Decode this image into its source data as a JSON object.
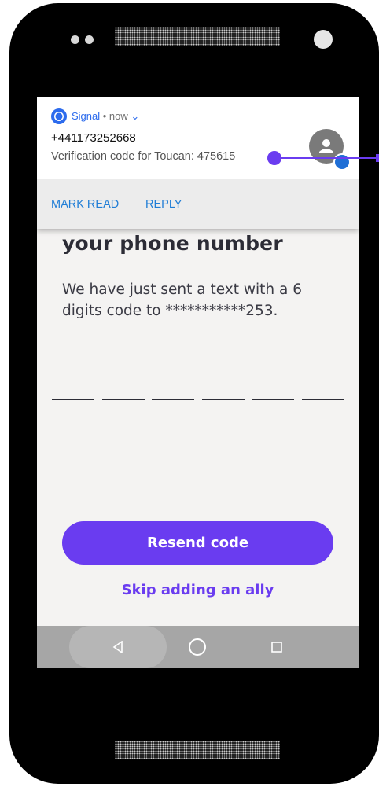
{
  "notification": {
    "app_name": "Signal",
    "separator": " • ",
    "time": "now",
    "chevron": "⌄",
    "sender": "+441173252668",
    "message": "Verification code for Toucan: 475615",
    "actions": [
      "MARK READ",
      "REPLY"
    ]
  },
  "screen": {
    "heading": "your phone number",
    "subtext": "We have just sent a text with a 6 digits code to ***********253.",
    "resend_label": "Resend code",
    "skip_label": "Skip adding an ally"
  },
  "colors": {
    "accent": "#6a3cf0",
    "signal_blue": "#2c6bed",
    "action_blue": "#1f7dd6"
  },
  "icons": [
    "signal-logo-icon",
    "chevron-down-icon",
    "avatar-person-icon",
    "reply-badge-icon",
    "back-icon",
    "home-icon",
    "recents-icon"
  ]
}
